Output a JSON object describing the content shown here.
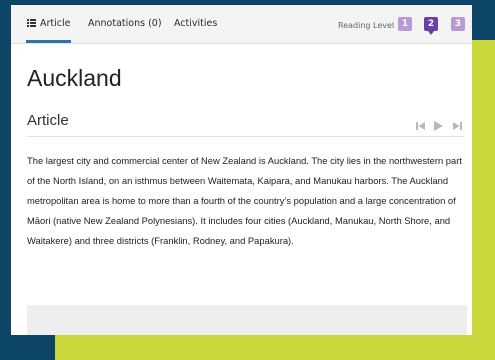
{
  "tabs": {
    "article": "Article",
    "annotations": "Annotations (0)",
    "activities": "Activities"
  },
  "reading_level": {
    "label": "Reading Level",
    "levels": [
      "1",
      "2",
      "3"
    ],
    "selected": "2"
  },
  "article": {
    "title": "Auckland",
    "section_heading": "Article",
    "body": "The largest city and commercial center of New Zealand is Auckland. The city lies in the northwestern part of the North Island, on an isthmus between Waitemata, Kaipara, and Manukau harbors. The Auckland metropolitan area is home to more than a fourth of the country’s population and a large concentration of Māori (native New Zealand Polynesians). It includes four cities (Auckland, Manukau, North Shore, and Waitakere) and three districts (Franklin, Rodney, and Papakura)."
  },
  "audio_controls": {
    "icons": [
      "skip-back-icon",
      "play-icon",
      "skip-forward-icon"
    ]
  },
  "colors": {
    "background_navy": "#0d4566",
    "background_yellow": "#c9d73a",
    "tab_underline": "#2b73b1",
    "level_inactive": "#b79ad6",
    "level_active": "#6b3fa8"
  }
}
